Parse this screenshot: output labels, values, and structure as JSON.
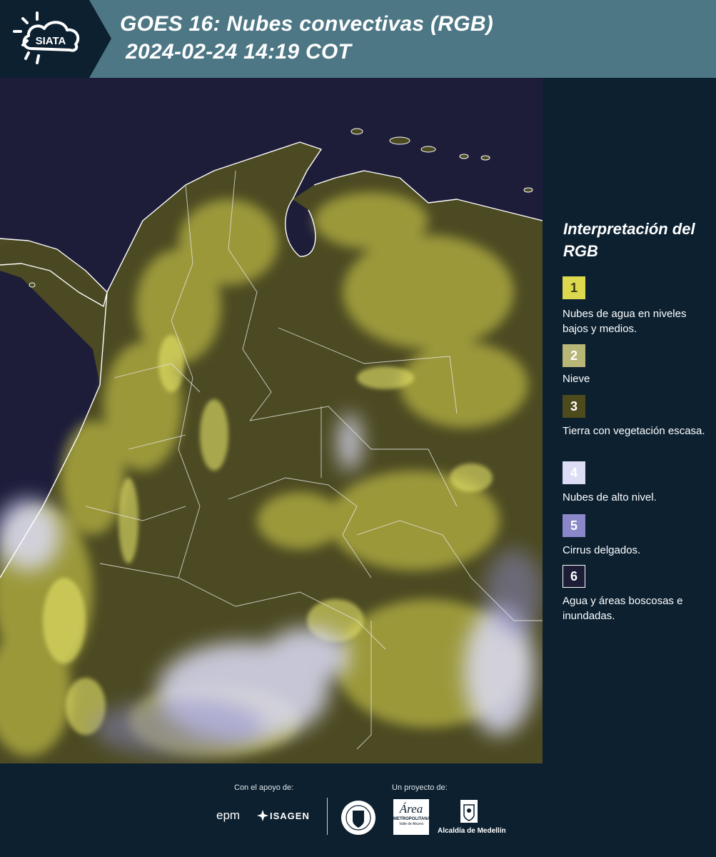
{
  "header": {
    "logo_text": "SIATA",
    "title_line1": "GOES 16: Nubes convectivas (RGB)",
    "title_line2": "2024-02-24 14:19 COT"
  },
  "legend": {
    "title": "Interpretación del RGB",
    "items": [
      {
        "number": "1",
        "label": "Nubes de agua en niveles bajos y medios.",
        "color": "#dcd94f",
        "text_color": "#3a3a10"
      },
      {
        "number": "2",
        "label": "Nieve",
        "color": "#b8b677",
        "text_color": "#ffffff"
      },
      {
        "number": "3",
        "label": "Tierra con vegetación escasa.",
        "color": "#4d4a1c",
        "text_color": "#ffffff"
      },
      {
        "number": "4",
        "label": "Nubes de alto nivel.",
        "color": "#dcdcf6",
        "text_color": "#ffffff"
      },
      {
        "number": "5",
        "label": "Cirrus delgados.",
        "color": "#8a88c9",
        "text_color": "#ffffff"
      },
      {
        "number": "6",
        "label": "Agua y áreas boscosas e inundadas.",
        "color": "#1d1d38",
        "text_color": "#ffffff"
      }
    ]
  },
  "footer": {
    "support_caption": "Con el apoyo de:",
    "project_caption": "Un proyecto de:",
    "sponsor_epm": "epm",
    "sponsor_isagen": "ISAGEN",
    "area_logo_text": "Área",
    "area_logo_subtext": "METROPOLITANA",
    "area_logo_subtext2": "Valle de Aburrá",
    "alcaldia_text": "Alcaldía de Medellín"
  },
  "colors": {
    "background": "#0c2030",
    "header": "#4d7785",
    "ocean": "#1d1d3a",
    "land": "#4c4a22",
    "low_cloud": "#dcd94f",
    "high_cloud": "#dcdcf6"
  }
}
